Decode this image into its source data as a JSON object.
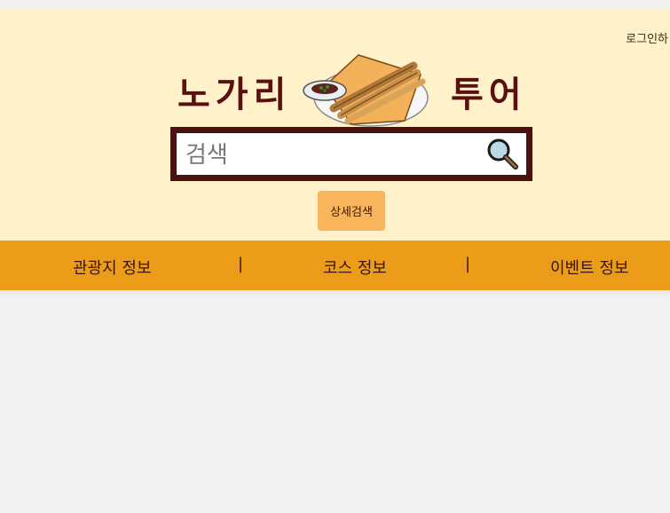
{
  "header": {
    "login_label": "로그인하",
    "title_left": "노가리",
    "title_right": "투어",
    "logo_icon": "dried-fish-plate-icon"
  },
  "search": {
    "placeholder": "검색",
    "value": "",
    "icon": "magnifier-icon"
  },
  "detail_search_label": "상세검색",
  "nav": {
    "items": [
      {
        "label": "관광지 정보"
      },
      {
        "label": "코스 정보"
      },
      {
        "label": "이벤트 정보"
      }
    ],
    "separator": "|"
  },
  "colors": {
    "header_bg": "#fff1c9",
    "nav_bg": "#eb9c18",
    "title": "#5a1010",
    "search_border": "#4b1010",
    "button": "#f8b55b"
  }
}
